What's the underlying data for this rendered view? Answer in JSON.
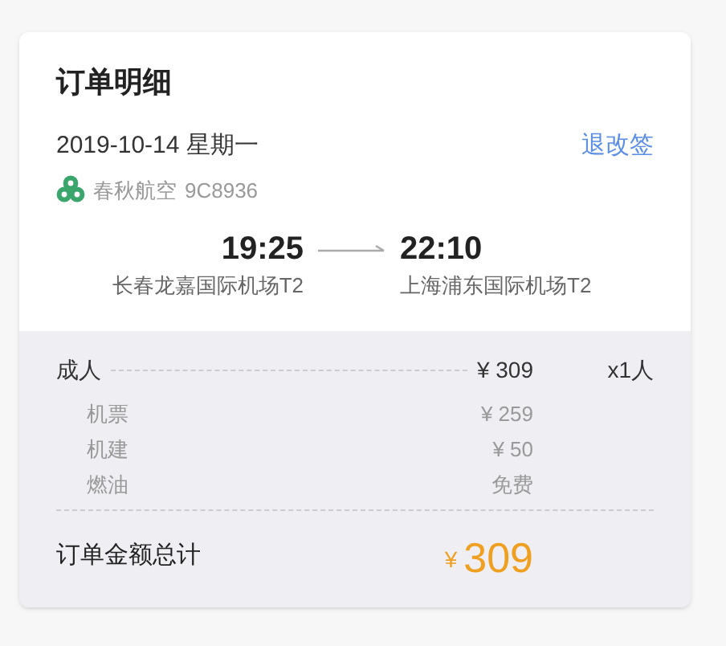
{
  "title": "订单明细",
  "date": "2019-10-14 星期一",
  "change_link": "退改签",
  "airline": {
    "name": "春秋航空",
    "flight_no": "9C8936"
  },
  "departure": {
    "time": "19:25",
    "airport": "长春龙嘉国际机场T2"
  },
  "arrival": {
    "time": "22:10",
    "airport": "上海浦东国际机场T2"
  },
  "passenger": {
    "label": "成人",
    "price": "¥ 309",
    "count": "x1人"
  },
  "fees": [
    {
      "label": "机票",
      "amount": "¥ 259"
    },
    {
      "label": "机建",
      "amount": "¥ 50"
    },
    {
      "label": "燃油",
      "amount": "免费"
    }
  ],
  "total": {
    "label": "订单金额总计",
    "currency": "¥",
    "amount": "309"
  }
}
